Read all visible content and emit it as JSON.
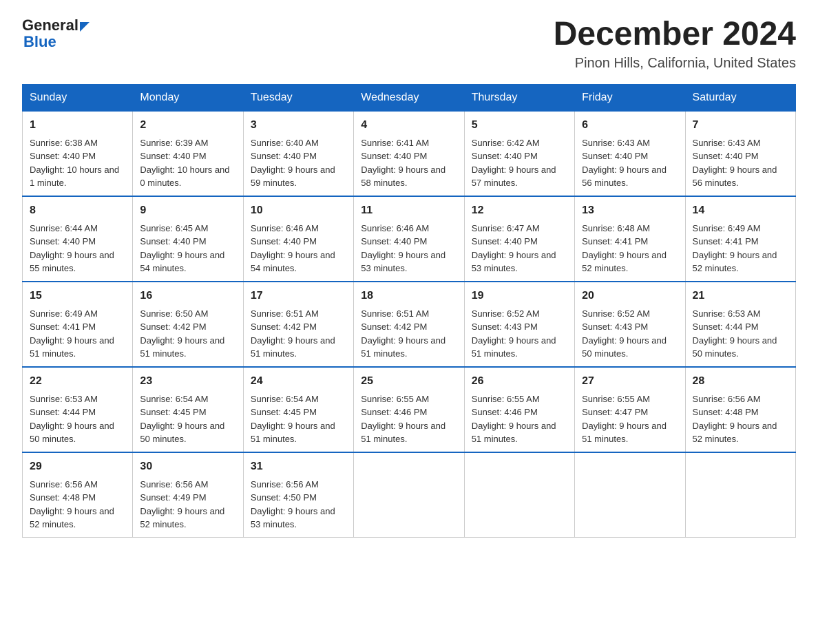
{
  "header": {
    "logo_general": "General",
    "logo_blue": "Blue",
    "title": "December 2024",
    "subtitle": "Pinon Hills, California, United States"
  },
  "days_of_week": [
    "Sunday",
    "Monday",
    "Tuesday",
    "Wednesday",
    "Thursday",
    "Friday",
    "Saturday"
  ],
  "weeks": [
    [
      {
        "day": "1",
        "sunrise": "6:38 AM",
        "sunset": "4:40 PM",
        "daylight": "10 hours and 1 minute."
      },
      {
        "day": "2",
        "sunrise": "6:39 AM",
        "sunset": "4:40 PM",
        "daylight": "10 hours and 0 minutes."
      },
      {
        "day": "3",
        "sunrise": "6:40 AM",
        "sunset": "4:40 PM",
        "daylight": "9 hours and 59 minutes."
      },
      {
        "day": "4",
        "sunrise": "6:41 AM",
        "sunset": "4:40 PM",
        "daylight": "9 hours and 58 minutes."
      },
      {
        "day": "5",
        "sunrise": "6:42 AM",
        "sunset": "4:40 PM",
        "daylight": "9 hours and 57 minutes."
      },
      {
        "day": "6",
        "sunrise": "6:43 AM",
        "sunset": "4:40 PM",
        "daylight": "9 hours and 56 minutes."
      },
      {
        "day": "7",
        "sunrise": "6:43 AM",
        "sunset": "4:40 PM",
        "daylight": "9 hours and 56 minutes."
      }
    ],
    [
      {
        "day": "8",
        "sunrise": "6:44 AM",
        "sunset": "4:40 PM",
        "daylight": "9 hours and 55 minutes."
      },
      {
        "day": "9",
        "sunrise": "6:45 AM",
        "sunset": "4:40 PM",
        "daylight": "9 hours and 54 minutes."
      },
      {
        "day": "10",
        "sunrise": "6:46 AM",
        "sunset": "4:40 PM",
        "daylight": "9 hours and 54 minutes."
      },
      {
        "day": "11",
        "sunrise": "6:46 AM",
        "sunset": "4:40 PM",
        "daylight": "9 hours and 53 minutes."
      },
      {
        "day": "12",
        "sunrise": "6:47 AM",
        "sunset": "4:40 PM",
        "daylight": "9 hours and 53 minutes."
      },
      {
        "day": "13",
        "sunrise": "6:48 AM",
        "sunset": "4:41 PM",
        "daylight": "9 hours and 52 minutes."
      },
      {
        "day": "14",
        "sunrise": "6:49 AM",
        "sunset": "4:41 PM",
        "daylight": "9 hours and 52 minutes."
      }
    ],
    [
      {
        "day": "15",
        "sunrise": "6:49 AM",
        "sunset": "4:41 PM",
        "daylight": "9 hours and 51 minutes."
      },
      {
        "day": "16",
        "sunrise": "6:50 AM",
        "sunset": "4:42 PM",
        "daylight": "9 hours and 51 minutes."
      },
      {
        "day": "17",
        "sunrise": "6:51 AM",
        "sunset": "4:42 PM",
        "daylight": "9 hours and 51 minutes."
      },
      {
        "day": "18",
        "sunrise": "6:51 AM",
        "sunset": "4:42 PM",
        "daylight": "9 hours and 51 minutes."
      },
      {
        "day": "19",
        "sunrise": "6:52 AM",
        "sunset": "4:43 PM",
        "daylight": "9 hours and 51 minutes."
      },
      {
        "day": "20",
        "sunrise": "6:52 AM",
        "sunset": "4:43 PM",
        "daylight": "9 hours and 50 minutes."
      },
      {
        "day": "21",
        "sunrise": "6:53 AM",
        "sunset": "4:44 PM",
        "daylight": "9 hours and 50 minutes."
      }
    ],
    [
      {
        "day": "22",
        "sunrise": "6:53 AM",
        "sunset": "4:44 PM",
        "daylight": "9 hours and 50 minutes."
      },
      {
        "day": "23",
        "sunrise": "6:54 AM",
        "sunset": "4:45 PM",
        "daylight": "9 hours and 50 minutes."
      },
      {
        "day": "24",
        "sunrise": "6:54 AM",
        "sunset": "4:45 PM",
        "daylight": "9 hours and 51 minutes."
      },
      {
        "day": "25",
        "sunrise": "6:55 AM",
        "sunset": "4:46 PM",
        "daylight": "9 hours and 51 minutes."
      },
      {
        "day": "26",
        "sunrise": "6:55 AM",
        "sunset": "4:46 PM",
        "daylight": "9 hours and 51 minutes."
      },
      {
        "day": "27",
        "sunrise": "6:55 AM",
        "sunset": "4:47 PM",
        "daylight": "9 hours and 51 minutes."
      },
      {
        "day": "28",
        "sunrise": "6:56 AM",
        "sunset": "4:48 PM",
        "daylight": "9 hours and 52 minutes."
      }
    ],
    [
      {
        "day": "29",
        "sunrise": "6:56 AM",
        "sunset": "4:48 PM",
        "daylight": "9 hours and 52 minutes."
      },
      {
        "day": "30",
        "sunrise": "6:56 AM",
        "sunset": "4:49 PM",
        "daylight": "9 hours and 52 minutes."
      },
      {
        "day": "31",
        "sunrise": "6:56 AM",
        "sunset": "4:50 PM",
        "daylight": "9 hours and 53 minutes."
      },
      null,
      null,
      null,
      null
    ]
  ]
}
